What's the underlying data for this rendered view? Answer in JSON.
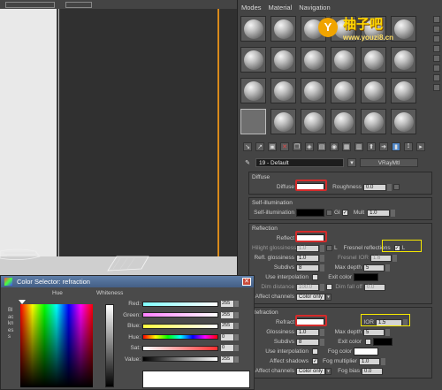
{
  "menu": [
    "Modes",
    "Material",
    "Navigation"
  ],
  "watermark": {
    "logo": "Y",
    "title": "柚子吧",
    "url": "www.youzi8.cn"
  },
  "material": {
    "name": "19 - Default",
    "type": "VRayMtl"
  },
  "diffuse": {
    "title": "Diffuse",
    "diffuse_label": "Diffuse",
    "roughness_label": "Roughness",
    "roughness_value": "0.0"
  },
  "selfillum": {
    "title": "Self-illumination",
    "label": "Self-illumination",
    "gi_label": "GI",
    "mult_label": "Mult",
    "mult_value": "1.0"
  },
  "reflection": {
    "title": "Reflection",
    "reflect_label": "Reflect",
    "hilight_label": "Hilight glossiness",
    "hilight_value": "1.0",
    "refl_gloss_label": "Refl. glossiness",
    "refl_gloss_value": "1.0",
    "fresnel_label": "Fresnel reflections",
    "fresnel_checked": "✓",
    "lock_label": "L",
    "fresnel_ior_label": "Fresnel IOR",
    "fresnel_ior_value": "1.6",
    "subdivs_label": "Subdivs",
    "subdivs_value": "8",
    "max_depth_label": "Max depth",
    "max_depth_value": "5",
    "use_interp_label": "Use interpolation",
    "exit_color_label": "Exit color",
    "dim_distance_label": "Dim distance",
    "dim_distance_value": "100.0",
    "dim_falloff_label": "Dim fall off",
    "dim_falloff_value": "0.0",
    "affect_channels_label": "Affect channels",
    "affect_channels_value": "Color only"
  },
  "refraction": {
    "title": "Refraction",
    "refract_label": "Refract",
    "ior_label": "IOR",
    "ior_value": "1.5",
    "gloss_label": "Glossiness",
    "gloss_value": "1.0",
    "max_depth_label": "Max depth",
    "max_depth_value": "5",
    "exit_color_label": "Exit color",
    "subdivs_label": "Subdivs",
    "subdivs_value": "8",
    "fog_color_label": "Fog color",
    "use_interp_label": "Use interpolation",
    "affect_shadows_label": "Affect shadows",
    "affect_shadows_checked": "✓",
    "fog_mult_label": "Fog multiplier",
    "fog_mult_value": "1.0",
    "affect_channels_label": "Affect channels",
    "affect_channels_value": "Color only",
    "fog_bias_label": "Fog bias",
    "fog_bias_value": "0.0"
  },
  "color_selector": {
    "title": "Color Selector: refraction",
    "hue_header": "Hue",
    "whiteness_header": "Whiteness",
    "blackness_label": "Blackness",
    "channels": [
      {
        "label": "Red:",
        "value": "255"
      },
      {
        "label": "Green:",
        "value": "255"
      },
      {
        "label": "Blue:",
        "value": "255"
      },
      {
        "label": "Hue:",
        "value": "0"
      },
      {
        "label": "Sat:",
        "value": "0"
      },
      {
        "label": "Value:",
        "value": "255"
      }
    ]
  },
  "colors": {
    "highlight_red": "#d42b2b",
    "highlight_yellow": "#f5e800",
    "swatch_white": "#ffffff",
    "swatch_black": "#000000"
  }
}
